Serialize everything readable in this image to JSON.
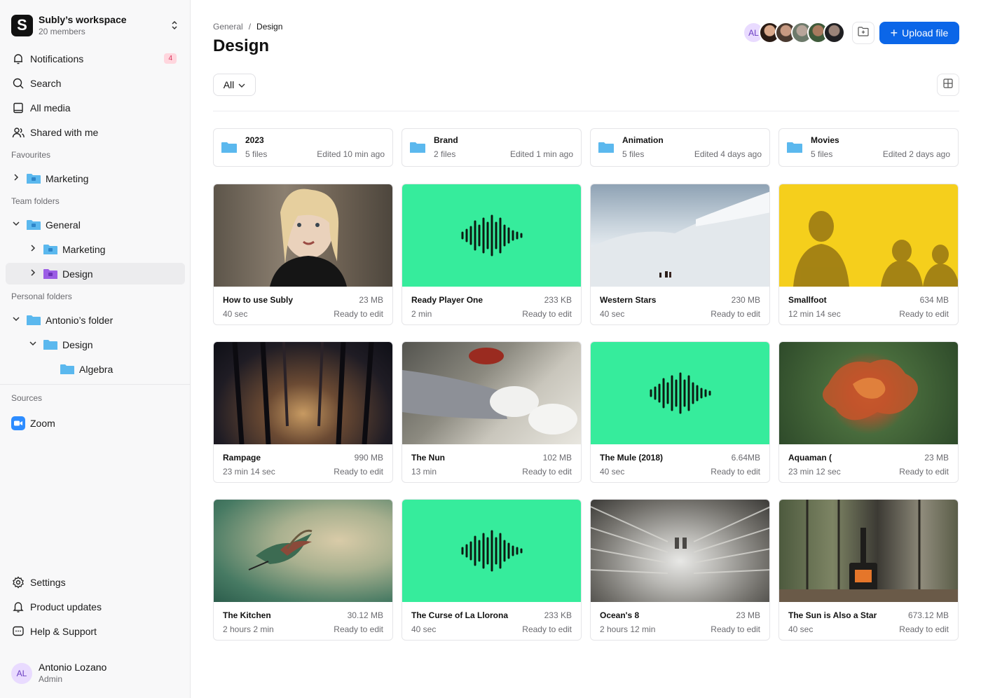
{
  "workspace": {
    "name": "Subly’s workspace",
    "members": "20 members",
    "logo_letter": "S"
  },
  "nav": {
    "notifications": "Notifications",
    "notifications_count": "4",
    "search": "Search",
    "all_media": "All media",
    "shared": "Shared with me"
  },
  "favourites": {
    "label": "Favourites",
    "items": [
      "Marketing"
    ]
  },
  "team_folders": {
    "label": "Team folders",
    "general": "General",
    "marketing": "Marketing",
    "design": "Design"
  },
  "personal_folders": {
    "label": "Personal folders",
    "antonio": "Antonio’s folder",
    "design": "Design",
    "algebra": "Algebra"
  },
  "sources": {
    "label": "Sources",
    "zoom": "Zoom"
  },
  "bottom_nav": {
    "settings": "Settings",
    "updates": "Product updates",
    "help": "Help & Support"
  },
  "user": {
    "initials": "AL",
    "name": "Antonio Lozano",
    "role": "Admin"
  },
  "breadcrumb": {
    "parent": "General",
    "separator": "/",
    "current": "Design"
  },
  "page_title": "Design",
  "collaborators": {
    "first_initials": "AL"
  },
  "upload_label": "Upload file",
  "filter_label": "All",
  "folders": [
    {
      "name": "2023",
      "files": "5 files",
      "edited": "Edited 10 min ago"
    },
    {
      "name": "Brand",
      "files": "2 files",
      "edited": "Edited 1 min ago"
    },
    {
      "name": "Animation",
      "files": "5 files",
      "edited": "Edited 4 days ago"
    },
    {
      "name": "Movies",
      "files": "5 files",
      "edited": "Edited 2 days ago"
    }
  ],
  "media": [
    {
      "title": "How to use Subly",
      "size": "23 MB",
      "duration": "40 sec",
      "status": "Ready to edit"
    },
    {
      "title": "Ready Player One",
      "size": "233 KB",
      "duration": "2 min",
      "status": "Ready to edit"
    },
    {
      "title": "Western Stars",
      "size": "230 MB",
      "duration": "40 sec",
      "status": "Ready to edit"
    },
    {
      "title": "Smallfoot",
      "size": "634 MB",
      "duration": "12 min 14 sec",
      "status": "Ready to edit"
    },
    {
      "title": "Rampage",
      "size": "990 MB",
      "duration": "23 min 14 sec",
      "status": "Ready to edit"
    },
    {
      "title": "The Nun",
      "size": "102 MB",
      "duration": "13 min",
      "status": "Ready to edit"
    },
    {
      "title": "The Mule (2018)",
      "size": "6.64MB",
      "duration": "40 sec",
      "status": "Ready to edit"
    },
    {
      "title": "Aquaman (",
      "size": "23 MB",
      "duration": "23 min 12 sec",
      "status": "Ready to edit"
    },
    {
      "title": "The Kitchen",
      "size": "30.12 MB",
      "duration": "2 hours 2 min",
      "status": "Ready to edit"
    },
    {
      "title": "The Curse of La Llorona",
      "size": "233 KB",
      "duration": "40 sec",
      "status": "Ready to edit"
    },
    {
      "title": "Ocean's 8",
      "size": "23 MB",
      "duration": "2 hours 12 min",
      "status": "Ready to edit"
    },
    {
      "title": "The Sun is Also a Star",
      "size": "673.12 MB",
      "duration": "40 sec",
      "status": "Ready to edit"
    }
  ],
  "colors": {
    "accent": "#0b66e8",
    "audio_thumb": "#36ec9c",
    "badge": "#d6335c",
    "folder": "#5bb8ee",
    "folder_purple": "#9b5de5"
  },
  "icons": {
    "folder": "folder-icon",
    "audio": "waveform-icon",
    "zoom": "zoom-icon"
  }
}
